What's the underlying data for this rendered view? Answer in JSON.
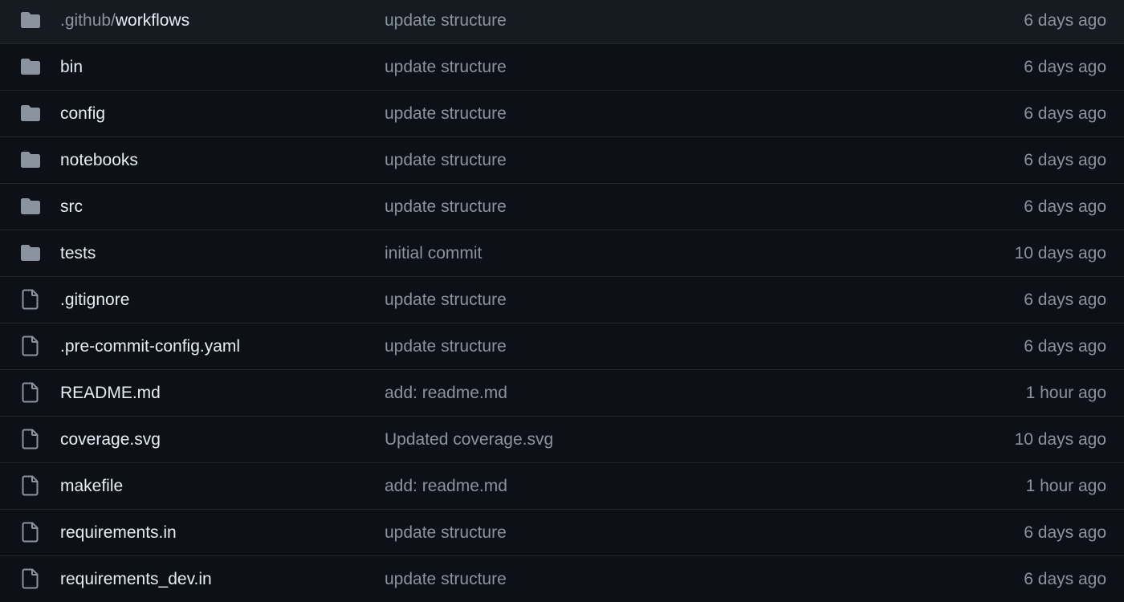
{
  "colors": {
    "background": "#0d1117",
    "divider": "#21262d",
    "primary_text": "#e6edf3",
    "muted_text": "#8b949e",
    "icon": "#8b949e"
  },
  "files": [
    {
      "type": "folder",
      "icon": "folder-icon",
      "prefix": ".github/",
      "name": "workflows",
      "commit": "update structure",
      "age": "6 days ago"
    },
    {
      "type": "folder",
      "icon": "folder-icon",
      "prefix": "",
      "name": "bin",
      "commit": "update structure",
      "age": "6 days ago"
    },
    {
      "type": "folder",
      "icon": "folder-icon",
      "prefix": "",
      "name": "config",
      "commit": "update structure",
      "age": "6 days ago"
    },
    {
      "type": "folder",
      "icon": "folder-icon",
      "prefix": "",
      "name": "notebooks",
      "commit": "update structure",
      "age": "6 days ago"
    },
    {
      "type": "folder",
      "icon": "folder-icon",
      "prefix": "",
      "name": "src",
      "commit": "update structure",
      "age": "6 days ago"
    },
    {
      "type": "folder",
      "icon": "folder-icon",
      "prefix": "",
      "name": "tests",
      "commit": "initial commit",
      "age": "10 days ago"
    },
    {
      "type": "file",
      "icon": "file-icon",
      "prefix": "",
      "name": ".gitignore",
      "commit": "update structure",
      "age": "6 days ago"
    },
    {
      "type": "file",
      "icon": "file-icon",
      "prefix": "",
      "name": ".pre-commit-config.yaml",
      "commit": "update structure",
      "age": "6 days ago"
    },
    {
      "type": "file",
      "icon": "file-icon",
      "prefix": "",
      "name": "README.md",
      "commit": "add: readme.md",
      "age": "1 hour ago"
    },
    {
      "type": "file",
      "icon": "file-icon",
      "prefix": "",
      "name": "coverage.svg",
      "commit": "Updated coverage.svg",
      "age": "10 days ago"
    },
    {
      "type": "file",
      "icon": "file-icon",
      "prefix": "",
      "name": "makefile",
      "commit": "add: readme.md",
      "age": "1 hour ago"
    },
    {
      "type": "file",
      "icon": "file-icon",
      "prefix": "",
      "name": "requirements.in",
      "commit": "update structure",
      "age": "6 days ago"
    },
    {
      "type": "file",
      "icon": "file-icon",
      "prefix": "",
      "name": "requirements_dev.in",
      "commit": "update structure",
      "age": "6 days ago"
    }
  ]
}
